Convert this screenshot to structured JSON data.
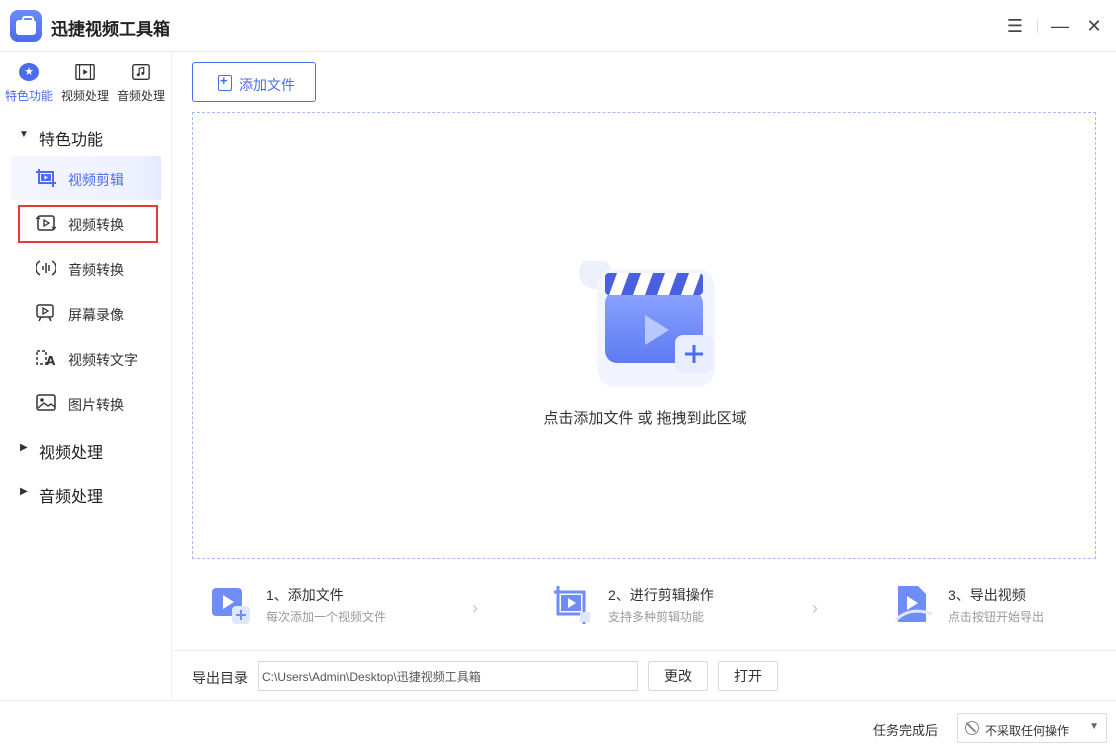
{
  "app": {
    "title": "迅捷视频工具箱"
  },
  "window_controls": {
    "menu": "☰",
    "minimize": "—",
    "close": "✕"
  },
  "sidebar": {
    "top_tabs": [
      {
        "label": "特色功能",
        "icon": "star-icon",
        "active": true
      },
      {
        "label": "视频处理",
        "icon": "film-icon",
        "active": false
      },
      {
        "label": "音频处理",
        "icon": "music-note-icon",
        "active": false
      }
    ],
    "sections": [
      {
        "label": "特色功能",
        "expanded": true
      },
      {
        "label": "视频处理",
        "expanded": false
      },
      {
        "label": "音频处理",
        "expanded": false
      }
    ],
    "items": [
      {
        "label": "视频剪辑",
        "icon": "video-crop-icon",
        "active": true
      },
      {
        "label": "视频转换",
        "icon": "video-convert-icon",
        "active": false,
        "highlighted": true
      },
      {
        "label": "音频转换",
        "icon": "audio-wave-icon",
        "active": false
      },
      {
        "label": "屏幕录像",
        "icon": "screen-record-icon",
        "active": false
      },
      {
        "label": "视频转文字",
        "icon": "video-to-text-icon",
        "active": false
      },
      {
        "label": "图片转换",
        "icon": "image-icon",
        "active": false
      }
    ]
  },
  "main": {
    "add_file_label": "添加文件",
    "dropzone_text": "点击添加文件 或 拖拽到此区域",
    "steps": [
      {
        "title": "1、添加文件",
        "subtitle": "每次添加一个视频文件",
        "icon": "add-video-icon"
      },
      {
        "title": "2、进行剪辑操作",
        "subtitle": "支持多种剪辑功能",
        "icon": "edit-video-icon"
      },
      {
        "title": "3、导出视频",
        "subtitle": "点击按钮开始导出",
        "icon": "export-video-icon"
      }
    ],
    "export": {
      "label": "导出目录",
      "path": "C:\\Users\\Admin\\Desktop\\迅捷视频工具箱",
      "change_label": "更改",
      "open_label": "打开"
    }
  },
  "bottom": {
    "task_label": "任务完成后",
    "task_value": "不采取任何操作"
  },
  "colors": {
    "accent": "#4a6cf0",
    "highlight_border": "#e53935"
  }
}
